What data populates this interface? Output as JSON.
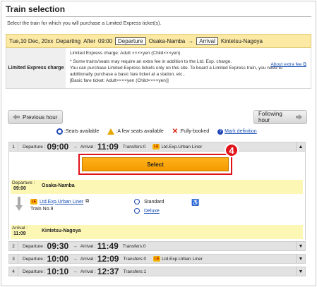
{
  "header": {
    "title": "Train selection",
    "instruction": "Select the train for which you will purchase a Limited Express ticket(s)."
  },
  "conditions": {
    "date": "Tue,10 Dec, 20xx",
    "departing_label": "Departing",
    "after_label": "After",
    "time": "09:00",
    "departure_tag": "Departure",
    "departure_station": "Osaka-Namba",
    "arrival_tag": "Arrival",
    "arrival_station": "Kintetsu-Nagoya"
  },
  "charge": {
    "label": "Limited Express charge",
    "line1": "Limited Express charge: Adult ××××yen (Child×××yen)",
    "line2": "* Some trains/seats may require an extra fee in addition to the Ltd. Exp. charge.",
    "line3": "You can purchase Limited Express tickets only on this site. To board a Limited Express train, you need to",
    "line4": "additionally purchase a basic fare ticket at a station, etc..",
    "line5": "[Basic fare ticket: Adult××××yen (Child××××yen)]",
    "about_link": "About extra fee"
  },
  "nav": {
    "previous": "Previous hour",
    "following": "Following hour"
  },
  "legend": {
    "available": ":Seats available",
    "few": ":A few seats available",
    "full": ":Fully-booked",
    "mark_def": "Mark definition"
  },
  "trains": [
    {
      "num": "1",
      "dep_label": "Departure :",
      "dep": "09:00",
      "arr_label": "Arrival :",
      "arr": "11:09",
      "transfers": "Transfers:0",
      "name": "Ltd.Exp.Urban Liner",
      "caret": "▲"
    },
    {
      "num": "2",
      "dep_label": "Departure :",
      "dep": "09:30",
      "arr_label": "Arrival :",
      "arr": "11:49",
      "transfers": "Transfers:0",
      "name": "",
      "caret": "▼"
    },
    {
      "num": "3",
      "dep_label": "Departure :",
      "dep": "10:00",
      "arr_label": "Arrival :",
      "arr": "12:09",
      "transfers": "Transfers:0",
      "name": "Ltd.Exp.Urban Liner",
      "caret": "▼"
    },
    {
      "num": "4",
      "dep_label": "Departure :",
      "dep": "10:10",
      "arr_label": "Arrival :",
      "arr": "12:37",
      "transfers": "Transfers:1",
      "name": "",
      "caret": "▼"
    }
  ],
  "detail": {
    "select_label": "Select",
    "step_badge": "4",
    "dep_label": "Departure :",
    "dep_time": "09:00",
    "dep_station": "Osaka-Namba",
    "train_name": "Ltd.Exp.Urban Liner",
    "train_no": "Train No.9",
    "seat_standard": "Standard",
    "seat_deluxe": "Deluxe",
    "arr_label": "Arrival :",
    "arr_time": "11:09",
    "arr_station": "Kintetsu-Nagoya"
  },
  "colors": {
    "accent_orange": "#f49a00",
    "highlight_red": "#e0121a",
    "link_blue": "#1a4fb5",
    "condition_bg": "#fbe9a4",
    "station_bg": "#fdf7b6"
  }
}
